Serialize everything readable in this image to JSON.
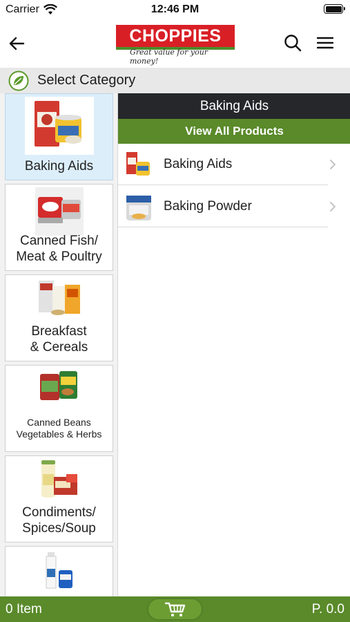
{
  "status_bar": {
    "carrier": "Carrier",
    "time": "12:46 PM"
  },
  "header": {
    "logo_text": "CHOPPIES",
    "tagline": "Great value for your money!",
    "back_icon": "arrow-left-icon",
    "search_icon": "search-icon",
    "menu_icon": "hamburger-menu-icon"
  },
  "category_bar": {
    "title": "Select Category"
  },
  "categories": [
    {
      "label": "Baking Aids",
      "selected": true
    },
    {
      "label": "Canned Fish/\nMeat & Poultry",
      "selected": false
    },
    {
      "label": "Breakfast\n& Cereals",
      "selected": false
    },
    {
      "label": "Canned Beans\nVegetables & Herbs",
      "selected": false
    },
    {
      "label": "Condiments/\nSpices/Soup",
      "selected": false
    },
    {
      "label": "",
      "selected": false
    }
  ],
  "panel": {
    "title": "Baking Aids",
    "view_all": "View All Products",
    "subcategories": [
      {
        "name": "Baking Aids"
      },
      {
        "name": "Baking Powder"
      }
    ]
  },
  "bottom_bar": {
    "cart_count": "0 Item",
    "cart_total": "P. 0.0",
    "cart_icon": "cart-icon"
  },
  "colors": {
    "brand_red": "#d91f26",
    "brand_green": "#5a8a2a",
    "panel_header": "#25272a",
    "selected_tile": "#dceefa"
  }
}
